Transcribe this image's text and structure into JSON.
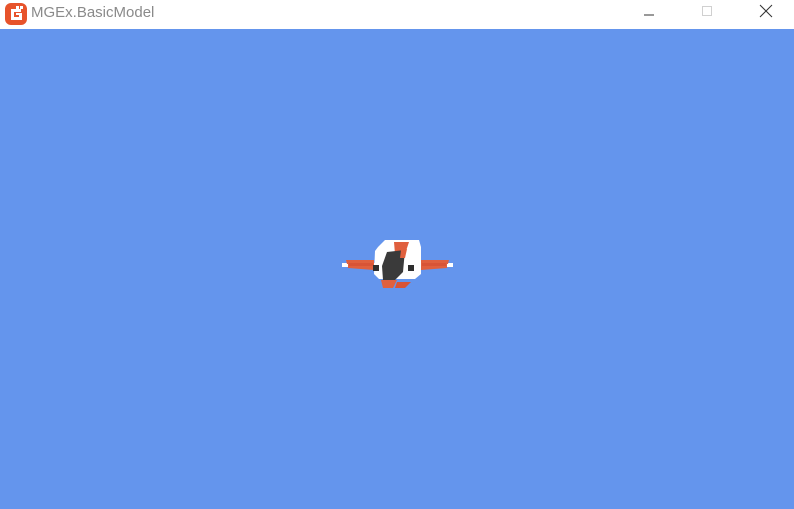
{
  "window": {
    "title": "MGEx.BasicModel",
    "app_icon": "monogame-logo-icon",
    "controls": {
      "minimize_icon": "minimize-icon",
      "maximize_icon": "maximize-icon",
      "close_icon": "close-icon"
    }
  },
  "scene": {
    "background_color": "#6495ED",
    "model": "ship-model",
    "model_colors": {
      "hull": "#ffffff",
      "accent": "#e0603e",
      "cockpit": "#3a3a3a"
    }
  }
}
